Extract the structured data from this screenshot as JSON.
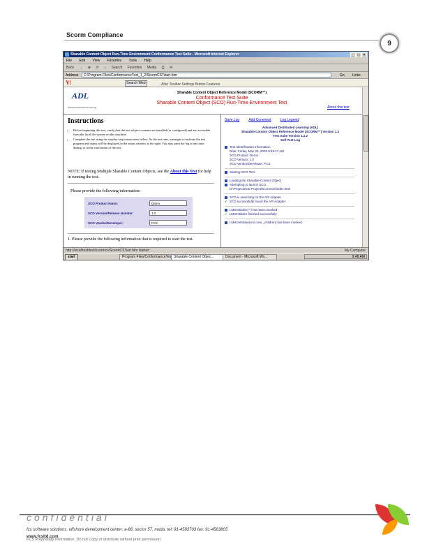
{
  "header": {
    "title": "Scorm Compliance",
    "page_number": "9"
  },
  "window": {
    "title": "Sharable Content Object Run-Time Environment Conformance Test Suite - Microsoft Internet Explorer",
    "controls": [
      "_",
      "□",
      "×"
    ],
    "menu": [
      "File",
      "Edit",
      "View",
      "Favorites",
      "Tools",
      "Help"
    ],
    "toolbar": [
      "Back",
      "→",
      "⊗",
      "⟳",
      "⌂",
      "Search",
      "Favorites",
      "Media",
      "⎙",
      "✉"
    ],
    "address_label": "Address",
    "address_value": "C:\\Program Files\\ConformanceTest_1_2\\ScormCSTstart.htm",
    "go_label": "Go",
    "links_label": "Links",
    "yahoo_logo": "Y!",
    "search_web": "Search Web",
    "yahoo_bar_text": "Alter Toolbar Settings Button Features"
  },
  "content": {
    "adl_logo": "ADL",
    "adl_sub": "Advanced Distributed Learning",
    "title_line1": "Sharable Content Object Reference Model (SCORM™)",
    "title_line2": "Conformance Test Suite",
    "title_line3": "Sharable Content Object (SCO) Run-Time Environment Test",
    "about_link": "About this test"
  },
  "instructions": {
    "heading": "Instructions",
    "bullets": [
      "Before beginning this test, verify that the test subject contents are installed (or configured) and are accessible from the local file system on this machine.",
      "Complete the test using the step-by-step instructions below. As the test runs, messages to indicate the test progress and status will be displayed in the status window at the right. You may print the log at any time during, or at the conclusion of the test."
    ],
    "note_prefix": "NOTE: If testing Multiple Sharable Content Objects, see the",
    "note_link": "About this Test",
    "note_suffix": "for help in running the test.",
    "provide_label": "Please provide the following information:",
    "fields": [
      {
        "label": "SCO Product Name:",
        "value": "Demo"
      },
      {
        "label": "SCO Version/Release Number:",
        "value": "1.0"
      },
      {
        "label": "SCO Vendor/Developer:",
        "value": "FCS"
      }
    ],
    "step1": "1.  Please provide the following information that is required to start the test."
  },
  "log": {
    "links": [
      "Save Log",
      "Add Comment",
      "Log Legend"
    ],
    "adv_lines": [
      "Advanced Distributed Learning (ADL)",
      "Sharable Content Object Reference Model (SCORM™) Version 1.2",
      "Test Suite Version 1.2.2",
      "Self Test Log"
    ],
    "entries": [
      {
        "icon": "b",
        "lines": [
          "Test Identification Information",
          "Date: Friday, May 30, 2003 9:48:17 AM",
          "SCO Product: Demo",
          "SCO Version: 1.0",
          "SCO Vendor/Developer: FCS"
        ]
      },
      {
        "icon": "b",
        "lines": [
          "Starting SCO Test"
        ]
      },
      {
        "icon": "b",
        "lines": [
          "Loading the Sharable Content Object",
          "Attempting to launch SCO",
          "D:\\Projects\\CD Project\\ScormCS\\index.html"
        ]
      },
      {
        "icon": "b",
        "lines": [
          "SCO is searching for the API Adapter"
        ]
      },
      {
        "icon": "ok",
        "lines": [
          "SCO successfully found the API Adapter"
        ]
      },
      {
        "icon": "b",
        "lines": [
          "LMSInitialize(\"\") has been invoked"
        ]
      },
      {
        "icon": "ok",
        "lines": [
          "LMSInitialize finished successfully"
        ]
      },
      {
        "icon": "b",
        "lines": [
          "LMSGetValue(cmi.core._children) has been invoked."
        ]
      }
    ]
  },
  "status_bar": {
    "text": "http://localhost/test/scormcs/ScormCSTest.htm started",
    "zone": "My Computer"
  },
  "taskbar": {
    "start": "start",
    "tasks": [
      "Program Files/ConformanceTest...",
      "Sharable Content Objec...",
      "Document - Microsoft Wo..."
    ],
    "tray": "9:48 AM"
  },
  "footer": {
    "confidential": "confidential",
    "address": "fcs software solutions. offshore development center: a-86, sector 57, noida. tel: 91-4583703 fax: 91-4583805",
    "www": "www.fcsltd.com",
    "proprietary": "FCS Proprietary Information. Do not Copy or distribute without prior permission"
  }
}
